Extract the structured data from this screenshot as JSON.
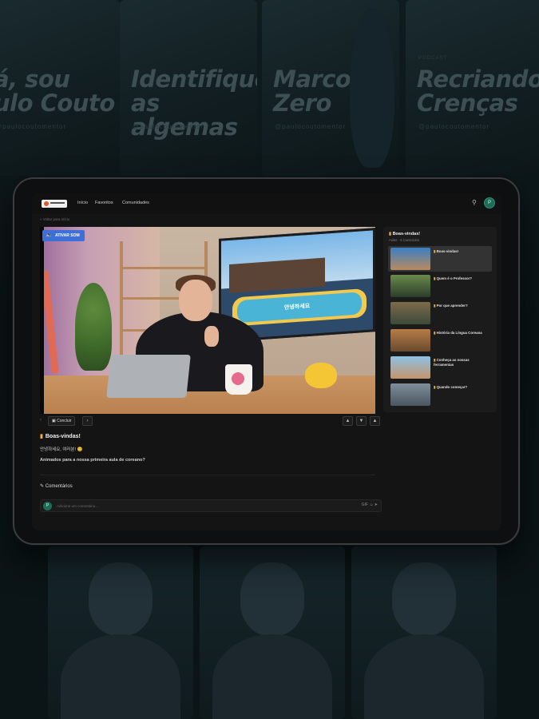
{
  "background": {
    "tiles": [
      {
        "text": "á, sou\nulo Couto",
        "tag": "@paulocoutomentor"
      },
      {
        "text": "Identifique\nas algemas",
        "tag": "@paulocoutomentor"
      },
      {
        "text": "Marco\nZero",
        "tag": "@paulocoutomentor"
      },
      {
        "text": "Recriando\nCrenças",
        "tag": "@paulocoutomentor",
        "top": "PODCAST"
      }
    ]
  },
  "nav": {
    "links": [
      "Início",
      "Favoritos",
      "Comunidades"
    ],
    "search_icon": "search-icon",
    "avatar_initial": "P"
  },
  "breadcrumb": "« Voltar para início",
  "video": {
    "badge_label": "ATIVAR SOM",
    "badge_icon": "speaker-muted-icon",
    "screen_text": "안녕하세요"
  },
  "controls": {
    "complete_label": "Concluir",
    "prev_icon": "chevron-left-icon",
    "next_icon": "chevron-right-icon",
    "right_icons": [
      "thumbs-up-icon",
      "thumbs-down-icon",
      "bookmark-icon"
    ]
  },
  "lesson": {
    "title": "Boas-vindas!",
    "line1": "안녕하세요, 여러분! 😊",
    "line2": "Animados para a nossa primeira aula de coreano?"
  },
  "comments": {
    "heading": "Comentários",
    "avatar_initial": "P",
    "placeholder": "Adicione um comentário...",
    "tools": "GIF ☺ ➤"
  },
  "playlist": {
    "title": "Boas-vindas!",
    "subtitle": "Aulas · 6 Conteúdos",
    "items": [
      {
        "label": "Boas-vindas!",
        "active": true,
        "colors": [
          "#3a7fc4",
          "#b98a5e"
        ]
      },
      {
        "label": "Quem é o Professor?",
        "active": false,
        "colors": [
          "#6a8a4c",
          "#2b3d2a"
        ]
      },
      {
        "label": "Por que aprender?",
        "active": false,
        "colors": [
          "#7d6a4a",
          "#3b4a3a"
        ]
      },
      {
        "label": "História da Língua Coreana",
        "active": false,
        "colors": [
          "#b67c46",
          "#6a4a2e"
        ]
      },
      {
        "label": "Conheça as nossas ferramentas",
        "active": false,
        "colors": [
          "#8ec1e6",
          "#c4956b"
        ]
      },
      {
        "label": "Quando começar?",
        "active": false,
        "colors": [
          "#7e8e9a",
          "#4a5660"
        ]
      }
    ]
  }
}
